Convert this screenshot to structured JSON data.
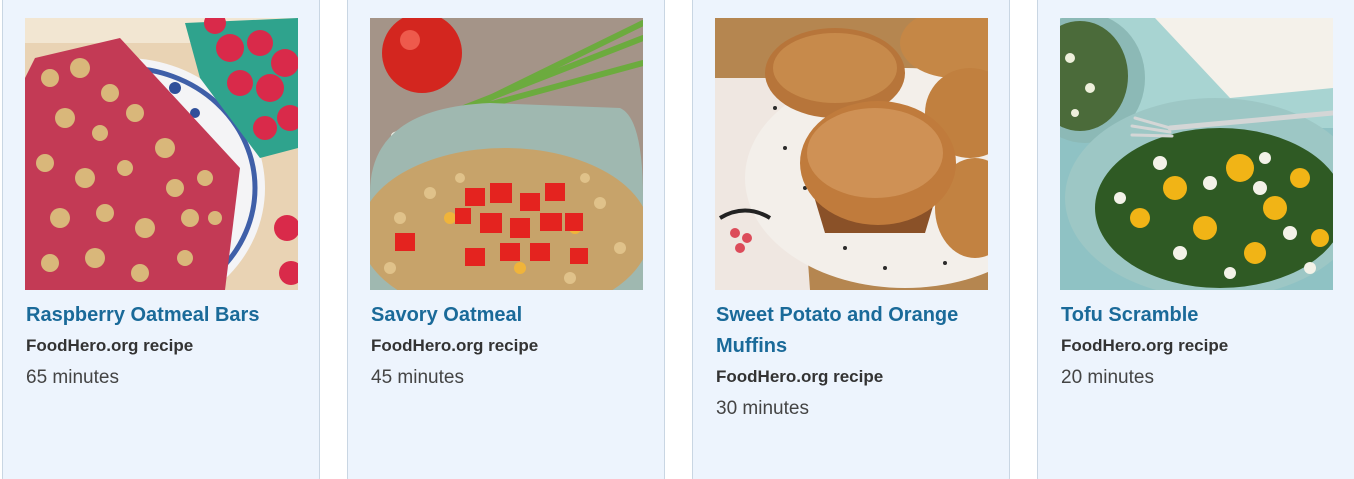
{
  "recipes": [
    {
      "title": "Raspberry Oatmeal Bars",
      "source": "FoodHero.org recipe",
      "time": "65 minutes"
    },
    {
      "title": "Savory Oatmeal",
      "source": "FoodHero.org recipe",
      "time": "45 minutes"
    },
    {
      "title": "Sweet Potato and Orange Muffins",
      "source": "FoodHero.org recipe",
      "time": "30 minutes"
    },
    {
      "title": "Tofu Scramble",
      "source": "FoodHero.org recipe",
      "time": "20 minutes"
    }
  ],
  "colors": {
    "card_bg": "#edf4fd",
    "card_border": "#c9d6e3",
    "title": "#1a6a99",
    "text": "#333333"
  }
}
